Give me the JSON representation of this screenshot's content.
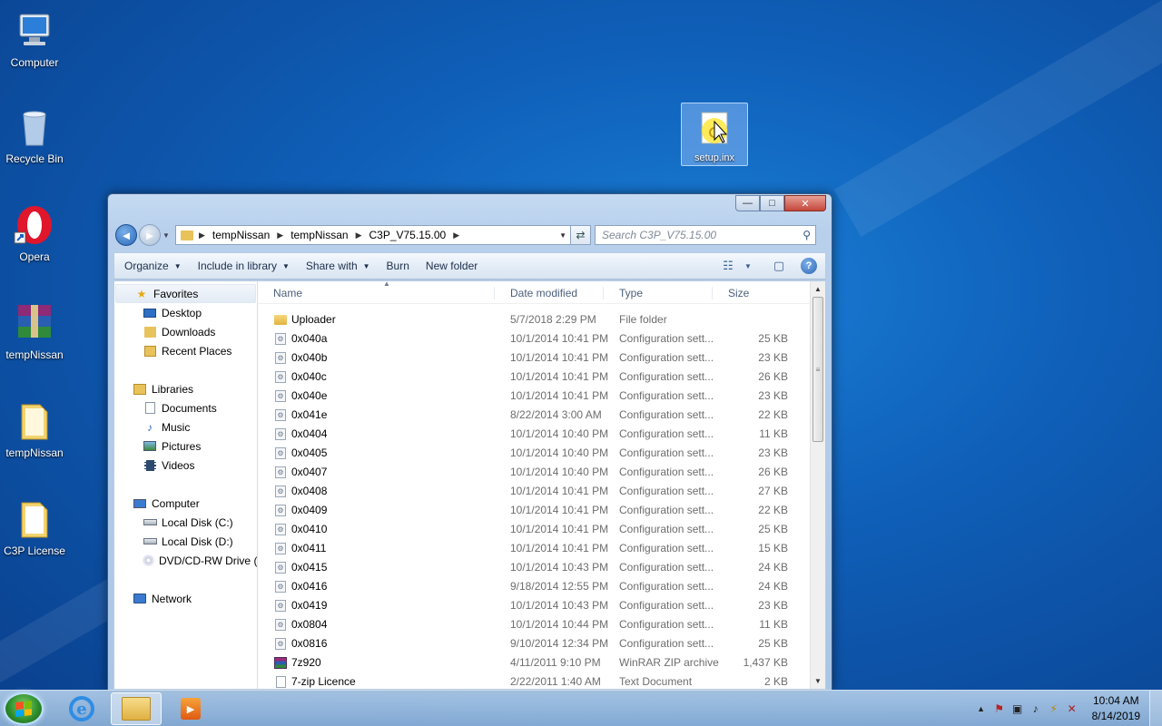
{
  "desktop": {
    "icons": [
      {
        "label": "Computer",
        "icon": "computer-icon"
      },
      {
        "label": "Recycle Bin",
        "icon": "recycle-bin-icon"
      },
      {
        "label": "Opera",
        "icon": "opera-icon"
      },
      {
        "label": "tempNissan",
        "icon": "winrar-archive-icon"
      },
      {
        "label": "tempNissan",
        "icon": "folder-icon"
      },
      {
        "label": "C3P License",
        "icon": "folder-icon"
      }
    ],
    "selected_icon": {
      "label": "setup.inx",
      "icon": "setup-file-icon"
    }
  },
  "window": {
    "caption": {
      "minimize": "—",
      "maximize": "□",
      "close": "✕"
    },
    "nav": {
      "back": "◄",
      "forward": "►",
      "dropdown": "▼"
    },
    "address": {
      "crumbs": [
        "tempNissan",
        "tempNissan",
        "C3P_V75.15.00"
      ],
      "separator": "▶",
      "dropdown": "▼",
      "refresh": "⇄"
    },
    "search": {
      "placeholder": "Search C3P_V75.15.00",
      "icon": "⚲"
    },
    "toolbar": {
      "organize": "Organize",
      "include_in_library": "Include in library",
      "share_with": "Share with",
      "burn": "Burn",
      "new_folder": "New folder",
      "caret": "▼",
      "view_icon": "☷",
      "preview_icon": "▢",
      "help": "?"
    },
    "navpane": {
      "favorites": "Favorites",
      "desktop": "Desktop",
      "downloads": "Downloads",
      "recent_places": "Recent Places",
      "libraries": "Libraries",
      "documents": "Documents",
      "music": "Music",
      "pictures": "Pictures",
      "videos": "Videos",
      "computer": "Computer",
      "local_c": "Local Disk (C:)",
      "local_d": "Local Disk (D:)",
      "dvd": "DVD/CD-RW Drive (I",
      "network": "Network"
    },
    "columns": {
      "name": "Name",
      "date": "Date modified",
      "type": "Type",
      "size": "Size",
      "sort_arrow": "▲"
    },
    "files": [
      {
        "name": "Uploader",
        "date": "5/7/2018 2:29 PM",
        "type": "File folder",
        "size": "",
        "kind": "folder"
      },
      {
        "name": "0x040a",
        "date": "10/1/2014 10:41 PM",
        "type": "Configuration sett...",
        "size": "25 KB",
        "kind": "config"
      },
      {
        "name": "0x040b",
        "date": "10/1/2014 10:41 PM",
        "type": "Configuration sett...",
        "size": "23 KB",
        "kind": "config"
      },
      {
        "name": "0x040c",
        "date": "10/1/2014 10:41 PM",
        "type": "Configuration sett...",
        "size": "26 KB",
        "kind": "config"
      },
      {
        "name": "0x040e",
        "date": "10/1/2014 10:41 PM",
        "type": "Configuration sett...",
        "size": "23 KB",
        "kind": "config"
      },
      {
        "name": "0x041e",
        "date": "8/22/2014 3:00 AM",
        "type": "Configuration sett...",
        "size": "22 KB",
        "kind": "config"
      },
      {
        "name": "0x0404",
        "date": "10/1/2014 10:40 PM",
        "type": "Configuration sett...",
        "size": "11 KB",
        "kind": "config"
      },
      {
        "name": "0x0405",
        "date": "10/1/2014 10:40 PM",
        "type": "Configuration sett...",
        "size": "23 KB",
        "kind": "config"
      },
      {
        "name": "0x0407",
        "date": "10/1/2014 10:40 PM",
        "type": "Configuration sett...",
        "size": "26 KB",
        "kind": "config"
      },
      {
        "name": "0x0408",
        "date": "10/1/2014 10:41 PM",
        "type": "Configuration sett...",
        "size": "27 KB",
        "kind": "config"
      },
      {
        "name": "0x0409",
        "date": "10/1/2014 10:41 PM",
        "type": "Configuration sett...",
        "size": "22 KB",
        "kind": "config"
      },
      {
        "name": "0x0410",
        "date": "10/1/2014 10:41 PM",
        "type": "Configuration sett...",
        "size": "25 KB",
        "kind": "config"
      },
      {
        "name": "0x0411",
        "date": "10/1/2014 10:41 PM",
        "type": "Configuration sett...",
        "size": "15 KB",
        "kind": "config"
      },
      {
        "name": "0x0415",
        "date": "10/1/2014 10:43 PM",
        "type": "Configuration sett...",
        "size": "24 KB",
        "kind": "config"
      },
      {
        "name": "0x0416",
        "date": "9/18/2014 12:55 PM",
        "type": "Configuration sett...",
        "size": "24 KB",
        "kind": "config"
      },
      {
        "name": "0x0419",
        "date": "10/1/2014 10:43 PM",
        "type": "Configuration sett...",
        "size": "23 KB",
        "kind": "config"
      },
      {
        "name": "0x0804",
        "date": "10/1/2014 10:44 PM",
        "type": "Configuration sett...",
        "size": "11 KB",
        "kind": "config"
      },
      {
        "name": "0x0816",
        "date": "9/10/2014 12:34 PM",
        "type": "Configuration sett...",
        "size": "25 KB",
        "kind": "config"
      },
      {
        "name": "7z920",
        "date": "4/11/2011 9:10 PM",
        "type": "WinRAR ZIP archive",
        "size": "1,437 KB",
        "kind": "archive"
      },
      {
        "name": "7-zip Licence",
        "date": "2/22/2011 1:40 AM",
        "type": "Text Document",
        "size": "2 KB",
        "kind": "text"
      }
    ],
    "scrollbar": {
      "up": "▲",
      "down": "▼",
      "grip": "≡"
    }
  },
  "taskbar": {
    "tray_show_hidden": "▲",
    "clock": {
      "time": "10:04 AM",
      "date": "8/14/2019"
    }
  }
}
